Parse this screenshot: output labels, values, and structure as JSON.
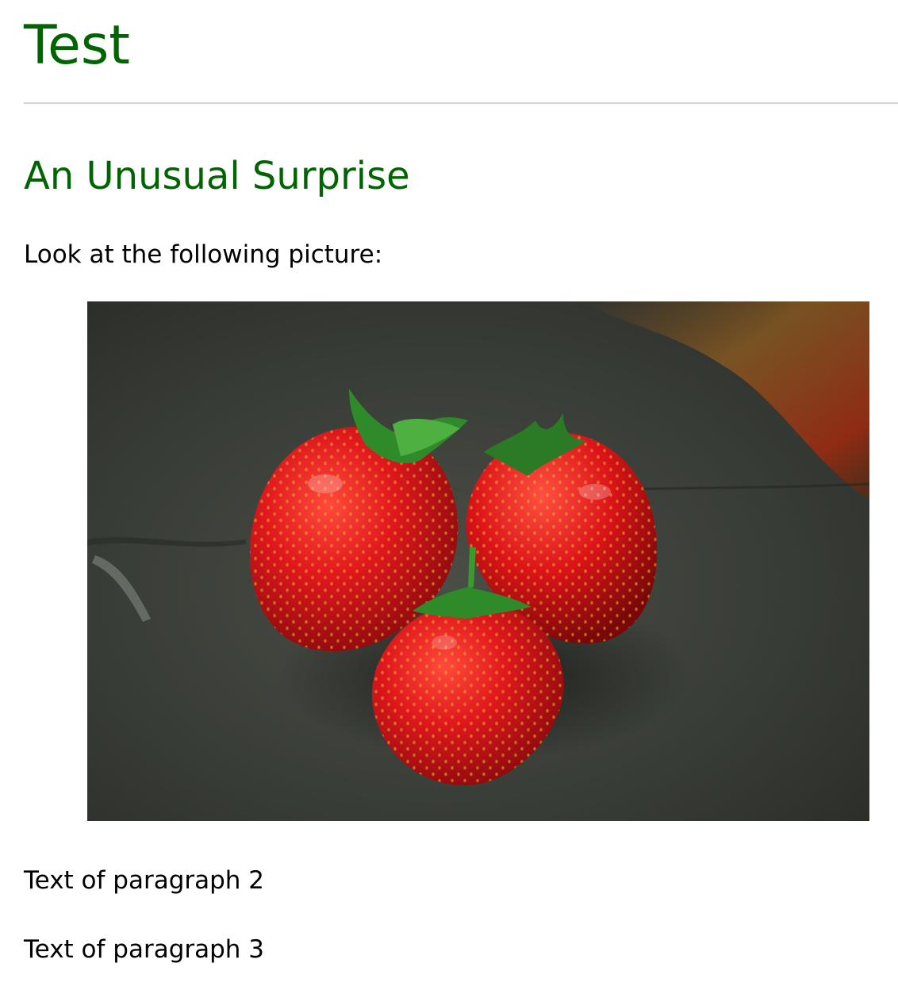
{
  "page": {
    "title": "Test",
    "section_title": "An Unusual Surprise",
    "intro_text": "Look at the following picture:",
    "paragraph_2": "Text of paragraph 2",
    "paragraph_3": "Text of paragraph 3"
  },
  "image": {
    "subject": "three-strawberries-photo",
    "colors": {
      "title_green": "#006400",
      "divider": "#d3d3d3",
      "slate_background": "#3c4138",
      "strawberry_red": "#d8141a",
      "leaf_green": "#2e8b2e"
    }
  }
}
